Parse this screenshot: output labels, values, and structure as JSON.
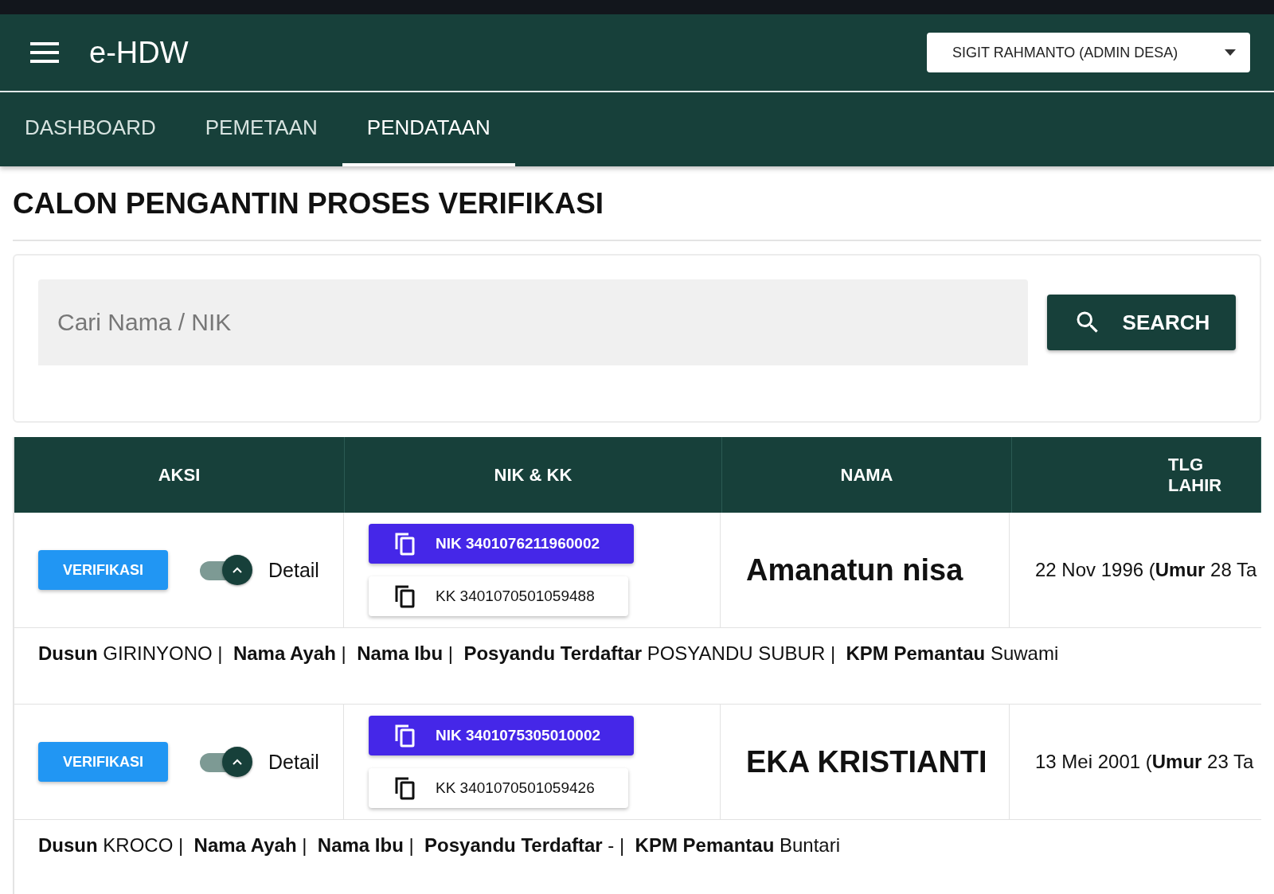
{
  "app": {
    "title": "e-HDW",
    "user": "SIGIT RAHMANTO (ADMIN DESA)"
  },
  "tabs": [
    {
      "label": "DASHBOARD",
      "selected": false
    },
    {
      "label": "PEMETAAN",
      "selected": false
    },
    {
      "label": "PENDATAAN",
      "selected": true
    }
  ],
  "page_title": "CALON PENGANTIN PROSES VERIFIKASI",
  "search": {
    "placeholder": "Cari Nama / NIK",
    "button": "SEARCH"
  },
  "table": {
    "columns": [
      "AKSI",
      "NIK & KK",
      "NAMA",
      "TLG LAHIR"
    ],
    "rows": [
      {
        "action": "VERIFIKASI",
        "detail_on": true,
        "detail_label": "Detail",
        "nik": "NIK 3401076211960002",
        "kk": "KK 3401070501059488",
        "name": "Amanatun nisa",
        "birth": "22 Nov 1996 (**Umur** 28 Ta",
        "info": "**Dusun** GIRINYONO |  **Nama Ayah** |  **Nama Ibu** |  **Posyandu Terdaftar** POSYANDU SUBUR |  **KPM Pemantau** Suwami"
      },
      {
        "action": "VERIFIKASI",
        "detail_on": true,
        "detail_label": "Detail",
        "nik": "NIK 3401075305010002",
        "kk": "KK 3401070501059426",
        "name": "EKA KRISTIANTI",
        "birth": "13 Mei 2001 (**Umur** 23 Ta",
        "info": "**Dusun** KROCO |  **Nama Ayah** |  **Nama Ibu** |  **Posyandu Terdaftar** - |  **KPM Pemantau** Buntari"
      }
    ]
  }
}
